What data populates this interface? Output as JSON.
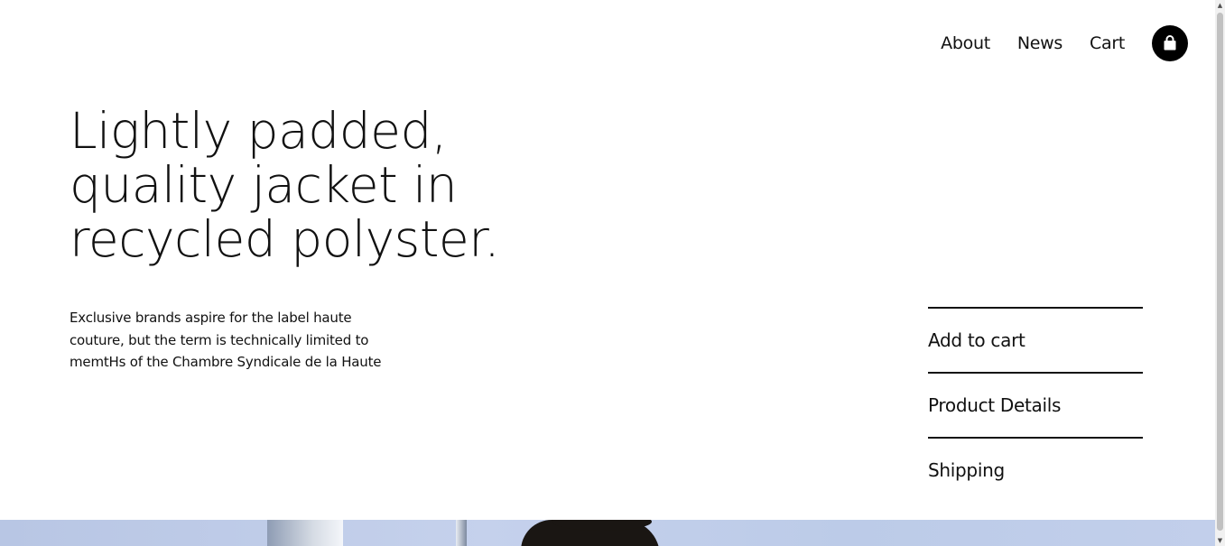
{
  "nav": {
    "links": [
      "About",
      "News",
      "Cart"
    ],
    "cart_icon": "shopping-bag-icon"
  },
  "hero": {
    "title_lines": [
      "Lightly padded,",
      "quality jacket in",
      "recycled polyster."
    ],
    "description_lines": [
      "Exclusive brands aspire for the label haute",
      "couture, but the term is technically limited to",
      "memtHs of the Chambre Syndicale de la Haute"
    ]
  },
  "side_menu": {
    "items": [
      "Add to cart",
      "Product Details",
      "Shipping"
    ]
  },
  "colors": {
    "text": "#111111",
    "background": "#ffffff",
    "button_bg": "#000000",
    "button_icon": "#ffffff"
  }
}
